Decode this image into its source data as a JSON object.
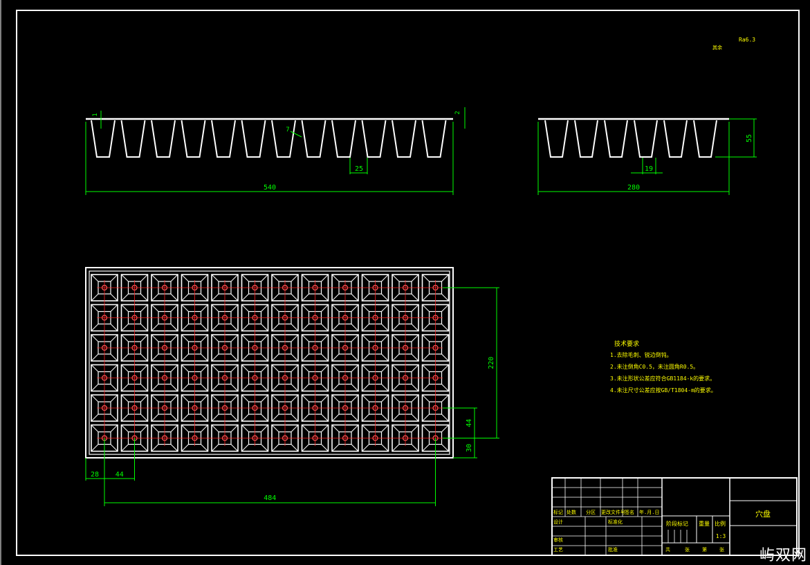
{
  "colors": {
    "background": "#000000",
    "outline": "#ffffff",
    "dimension": "#00ff00",
    "centerline": "#ff2020",
    "hole": "#ff6060",
    "annotation": "#ffff00",
    "title_text": "#ffff00"
  },
  "surface_finish": {
    "prefix": "其余",
    "value": "Ra6.3"
  },
  "front_view": {
    "dims": {
      "overall_length": "540",
      "cell_pitch": "25",
      "rim_left": "1",
      "rim_right": "2",
      "slope_angle": "7"
    }
  },
  "side_view": {
    "dims": {
      "overall_width": "280",
      "cell_pitch": "19",
      "depth": "55"
    }
  },
  "top_view": {
    "grid": {
      "cols": 12,
      "rows": 6
    },
    "dims": {
      "left_margin": "28",
      "pitch_x": "44",
      "pitch_y": "44",
      "bottom_margin": "30",
      "span_y": "220",
      "span_x": "484"
    }
  },
  "tech_requirements": {
    "title": "技术要求",
    "items": [
      "1.去除毛刺、锐边倒钝。",
      "2.未注倒角C0.5，未注圆角R0.5。",
      "3.未注形状公差应符合GB1184-k的要求。",
      "4.未注尺寸公差应按GB/T1804-m的要求。"
    ]
  },
  "title_block": {
    "part_name": "穴盘",
    "scale": "1:3",
    "headers": [
      "标记",
      "处数",
      "分区",
      "更改文件号",
      "签名",
      "年.月.日"
    ],
    "roles": [
      "设计",
      "标准化",
      "审核",
      "工艺",
      "批准"
    ],
    "labels": [
      "阶段标记",
      "重量",
      "比例"
    ],
    "sheet": [
      "共",
      "张",
      "第",
      "张"
    ]
  },
  "watermark": "屿双网"
}
